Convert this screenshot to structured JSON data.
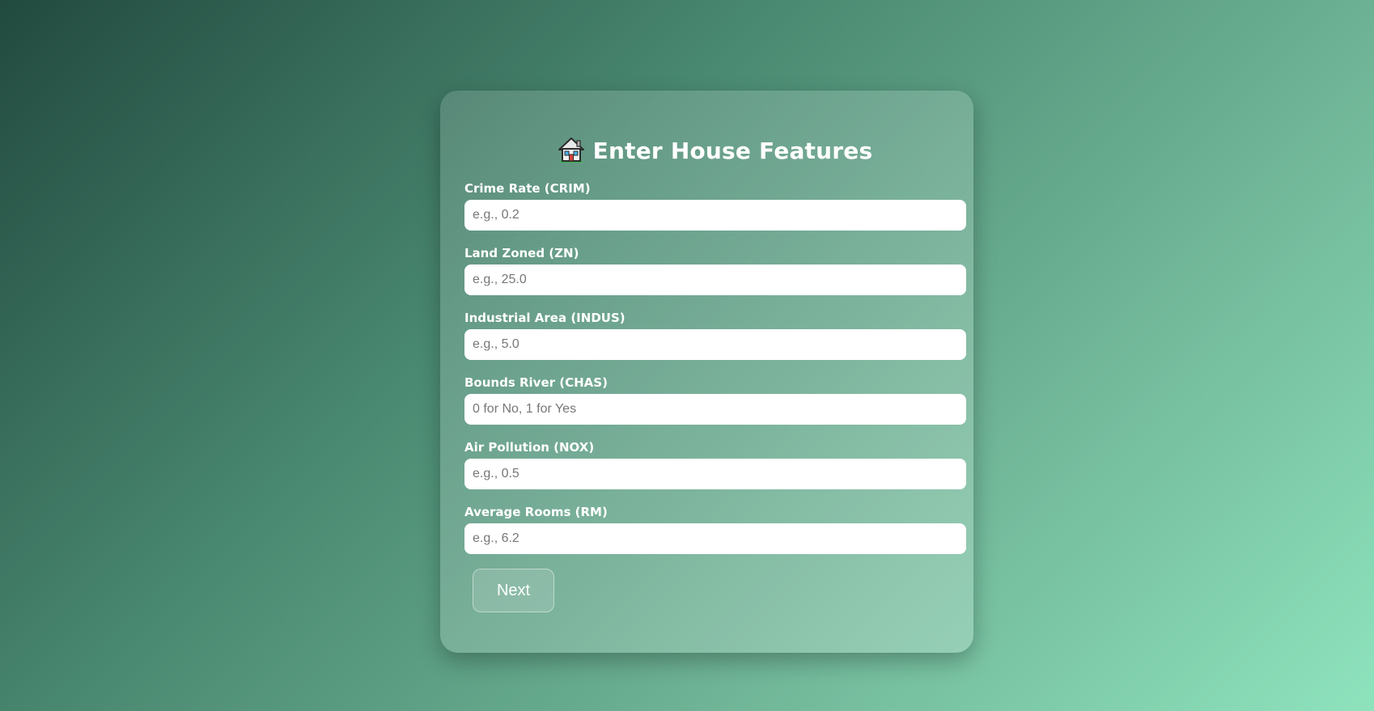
{
  "form": {
    "title": "Enter House Features",
    "title_icon": "house-icon",
    "fields": [
      {
        "label": "Crime Rate (CRIM)",
        "placeholder": "e.g., 0.2",
        "value": ""
      },
      {
        "label": "Land Zoned (ZN)",
        "placeholder": "e.g., 25.0",
        "value": ""
      },
      {
        "label": "Industrial Area (INDUS)",
        "placeholder": "e.g., 5.0",
        "value": ""
      },
      {
        "label": "Bounds River (CHAS)",
        "placeholder": "0 for No, 1 for Yes",
        "value": ""
      },
      {
        "label": "Air Pollution (NOX)",
        "placeholder": "e.g., 0.5",
        "value": ""
      },
      {
        "label": "Average Rooms (RM)",
        "placeholder": "e.g., 6.2",
        "value": ""
      }
    ],
    "next_label": "Next"
  },
  "colors": {
    "background_start": "#224a3f",
    "background_end": "#8ee3bd",
    "text": "#ffffff"
  }
}
